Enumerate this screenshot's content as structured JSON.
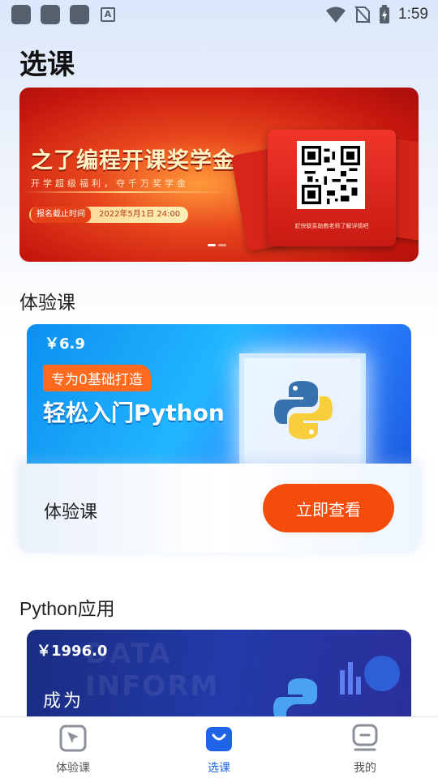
{
  "status_bar": {
    "time": "1:59",
    "notif_icon_letter": "A"
  },
  "page": {
    "title": "选课"
  },
  "banner": {
    "title": "之了编程开课奖学金",
    "subtitle": "开学超级福利，夺千万奖学金",
    "deadline_label": "报名截止时间",
    "deadline_value": "2022年5月1日 24:00",
    "qr_caption": "赶快联系助教老师了解详情吧"
  },
  "sections": {
    "experience": {
      "title": "体验课",
      "course": {
        "price": "￥6.9",
        "flag": "专为0基础打造",
        "headline": "轻松入门Python",
        "name": "体验课",
        "button": "立即查看"
      }
    },
    "python_app": {
      "title": "Python应用",
      "course": {
        "price": "￥1996.0",
        "headline": "成为"
      }
    }
  },
  "bottom_nav": {
    "items": [
      {
        "label": "体验课"
      },
      {
        "label": "选课"
      },
      {
        "label": "我的"
      }
    ],
    "active_index": 1
  },
  "colors": {
    "accent": "#1e63e8",
    "button": "#f44c0c",
    "banner_red": "#c7180f"
  }
}
